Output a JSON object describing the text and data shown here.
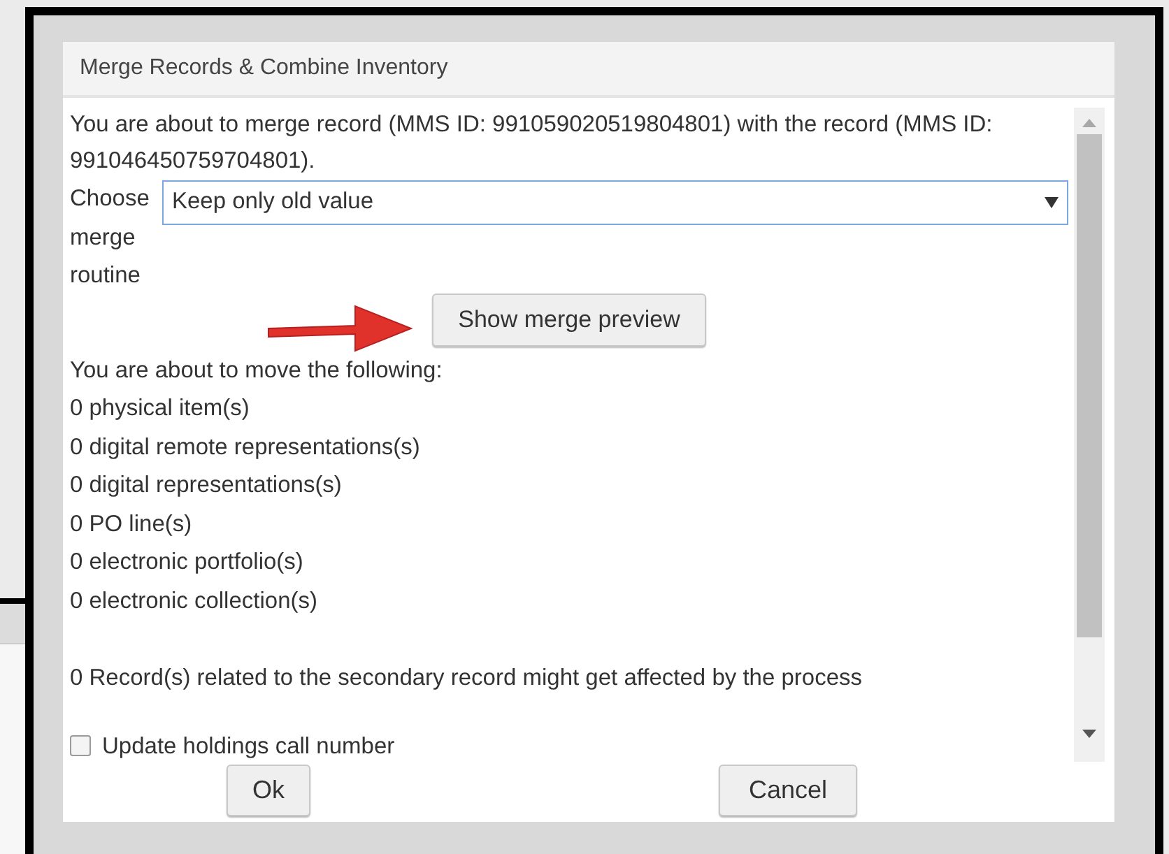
{
  "dialog": {
    "title": "Merge Records & Combine Inventory",
    "message": "You are about to merge record (MMS ID: 991059020519804801) with the record (MMS ID: 991046450759704801).",
    "merge_routine": {
      "label": "Choose merge routine",
      "value": "Keep only old value"
    },
    "preview_button": "Show merge preview",
    "move_heading": "You are about to move the following:",
    "move_items": [
      "0 physical item(s)",
      "0 digital remote representations(s)",
      "0 digital representations(s)",
      "0 PO line(s)",
      "0 electronic portfolio(s)",
      "0 electronic collection(s)"
    ],
    "related_note": "0 Record(s) related to the secondary record might get affected by the process",
    "options": [
      {
        "label": "Update holdings call number",
        "checked": false
      }
    ],
    "buttons": [
      "Ok",
      "Cancel"
    ]
  }
}
